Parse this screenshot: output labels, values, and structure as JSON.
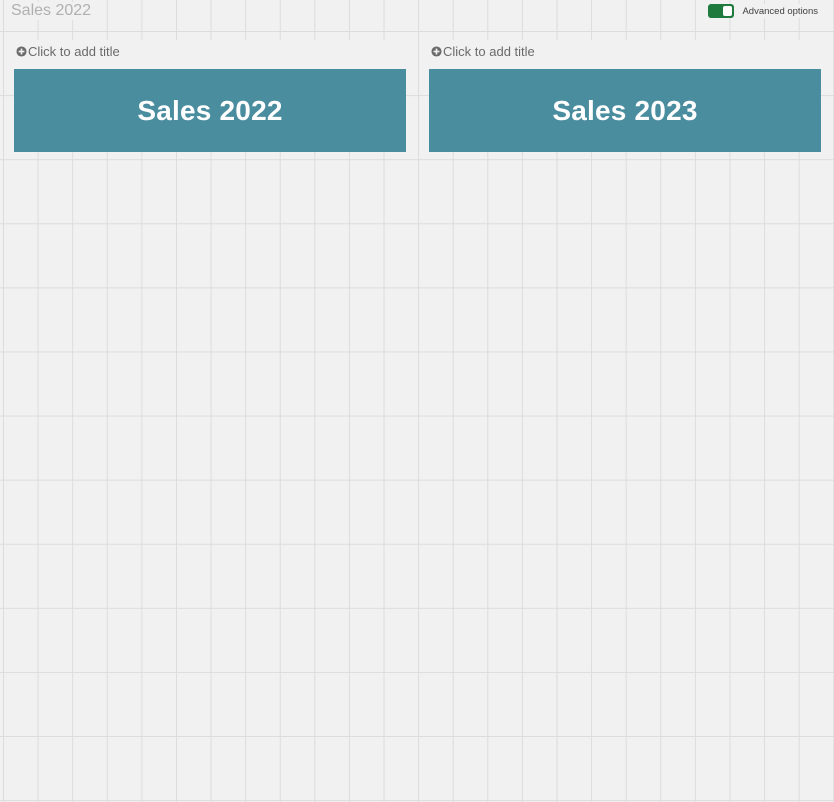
{
  "sheet": {
    "title": "Sales 2022"
  },
  "header": {
    "advanced_options_label": "Advanced options",
    "advanced_options_enabled": true
  },
  "panels": [
    {
      "add_title_label": "Click to add title",
      "value_text": "Sales 2022"
    },
    {
      "add_title_label": "Click to add title",
      "value_text": "Sales 2023"
    }
  ],
  "colors": {
    "kpi_background": "#4a8d9f",
    "toggle_on": "#1f7a3e",
    "canvas_background": "#f2f1f1"
  }
}
